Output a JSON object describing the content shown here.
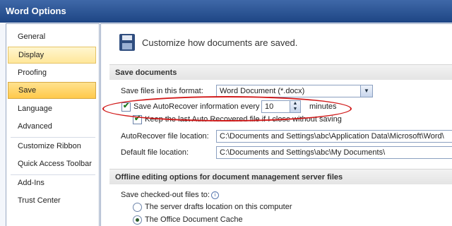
{
  "window": {
    "title": "Word Options"
  },
  "sidebar": {
    "items": [
      {
        "label": "General"
      },
      {
        "label": "Display"
      },
      {
        "label": "Proofing"
      },
      {
        "label": "Save"
      },
      {
        "label": "Language"
      },
      {
        "label": "Advanced"
      },
      {
        "label": "Customize Ribbon"
      },
      {
        "label": "Quick Access Toolbar"
      },
      {
        "label": "Add-Ins"
      },
      {
        "label": "Trust Center"
      }
    ]
  },
  "main": {
    "header": "Customize how documents are saved.",
    "save_section": {
      "title": "Save documents",
      "format_label": "Save files in this format:",
      "format_value": "Word Document (*.docx)",
      "autorecover_label": "Save AutoRecover information every",
      "autorecover_value": "10",
      "autorecover_unit": "minutes",
      "keep_label": "Keep the last Auto Recovered file if I close without saving",
      "ar_location_label": "AutoRecover file location:",
      "ar_location_value": "C:\\Documents and Settings\\abc\\Application Data\\Microsoft\\Word\\",
      "default_location_label": "Default file location:",
      "default_location_value": "C:\\Documents and Settings\\abc\\My Documents\\"
    },
    "offline_section": {
      "title": "Offline editing options for document management server files",
      "checked_out_label": "Save checked-out files to:",
      "option1": "The server drafts location on this computer",
      "option2": "The Office Document Cache"
    }
  },
  "icons": [
    "save-icon",
    "info-icon",
    "checkbox-checked",
    "radio-selected",
    "dropdown-arrow",
    "spinner-arrows"
  ],
  "colors": {
    "title_bar": "#1d4584",
    "selected_nav": "#ffc94a",
    "highlight_ellipse": "#d11a1a"
  }
}
